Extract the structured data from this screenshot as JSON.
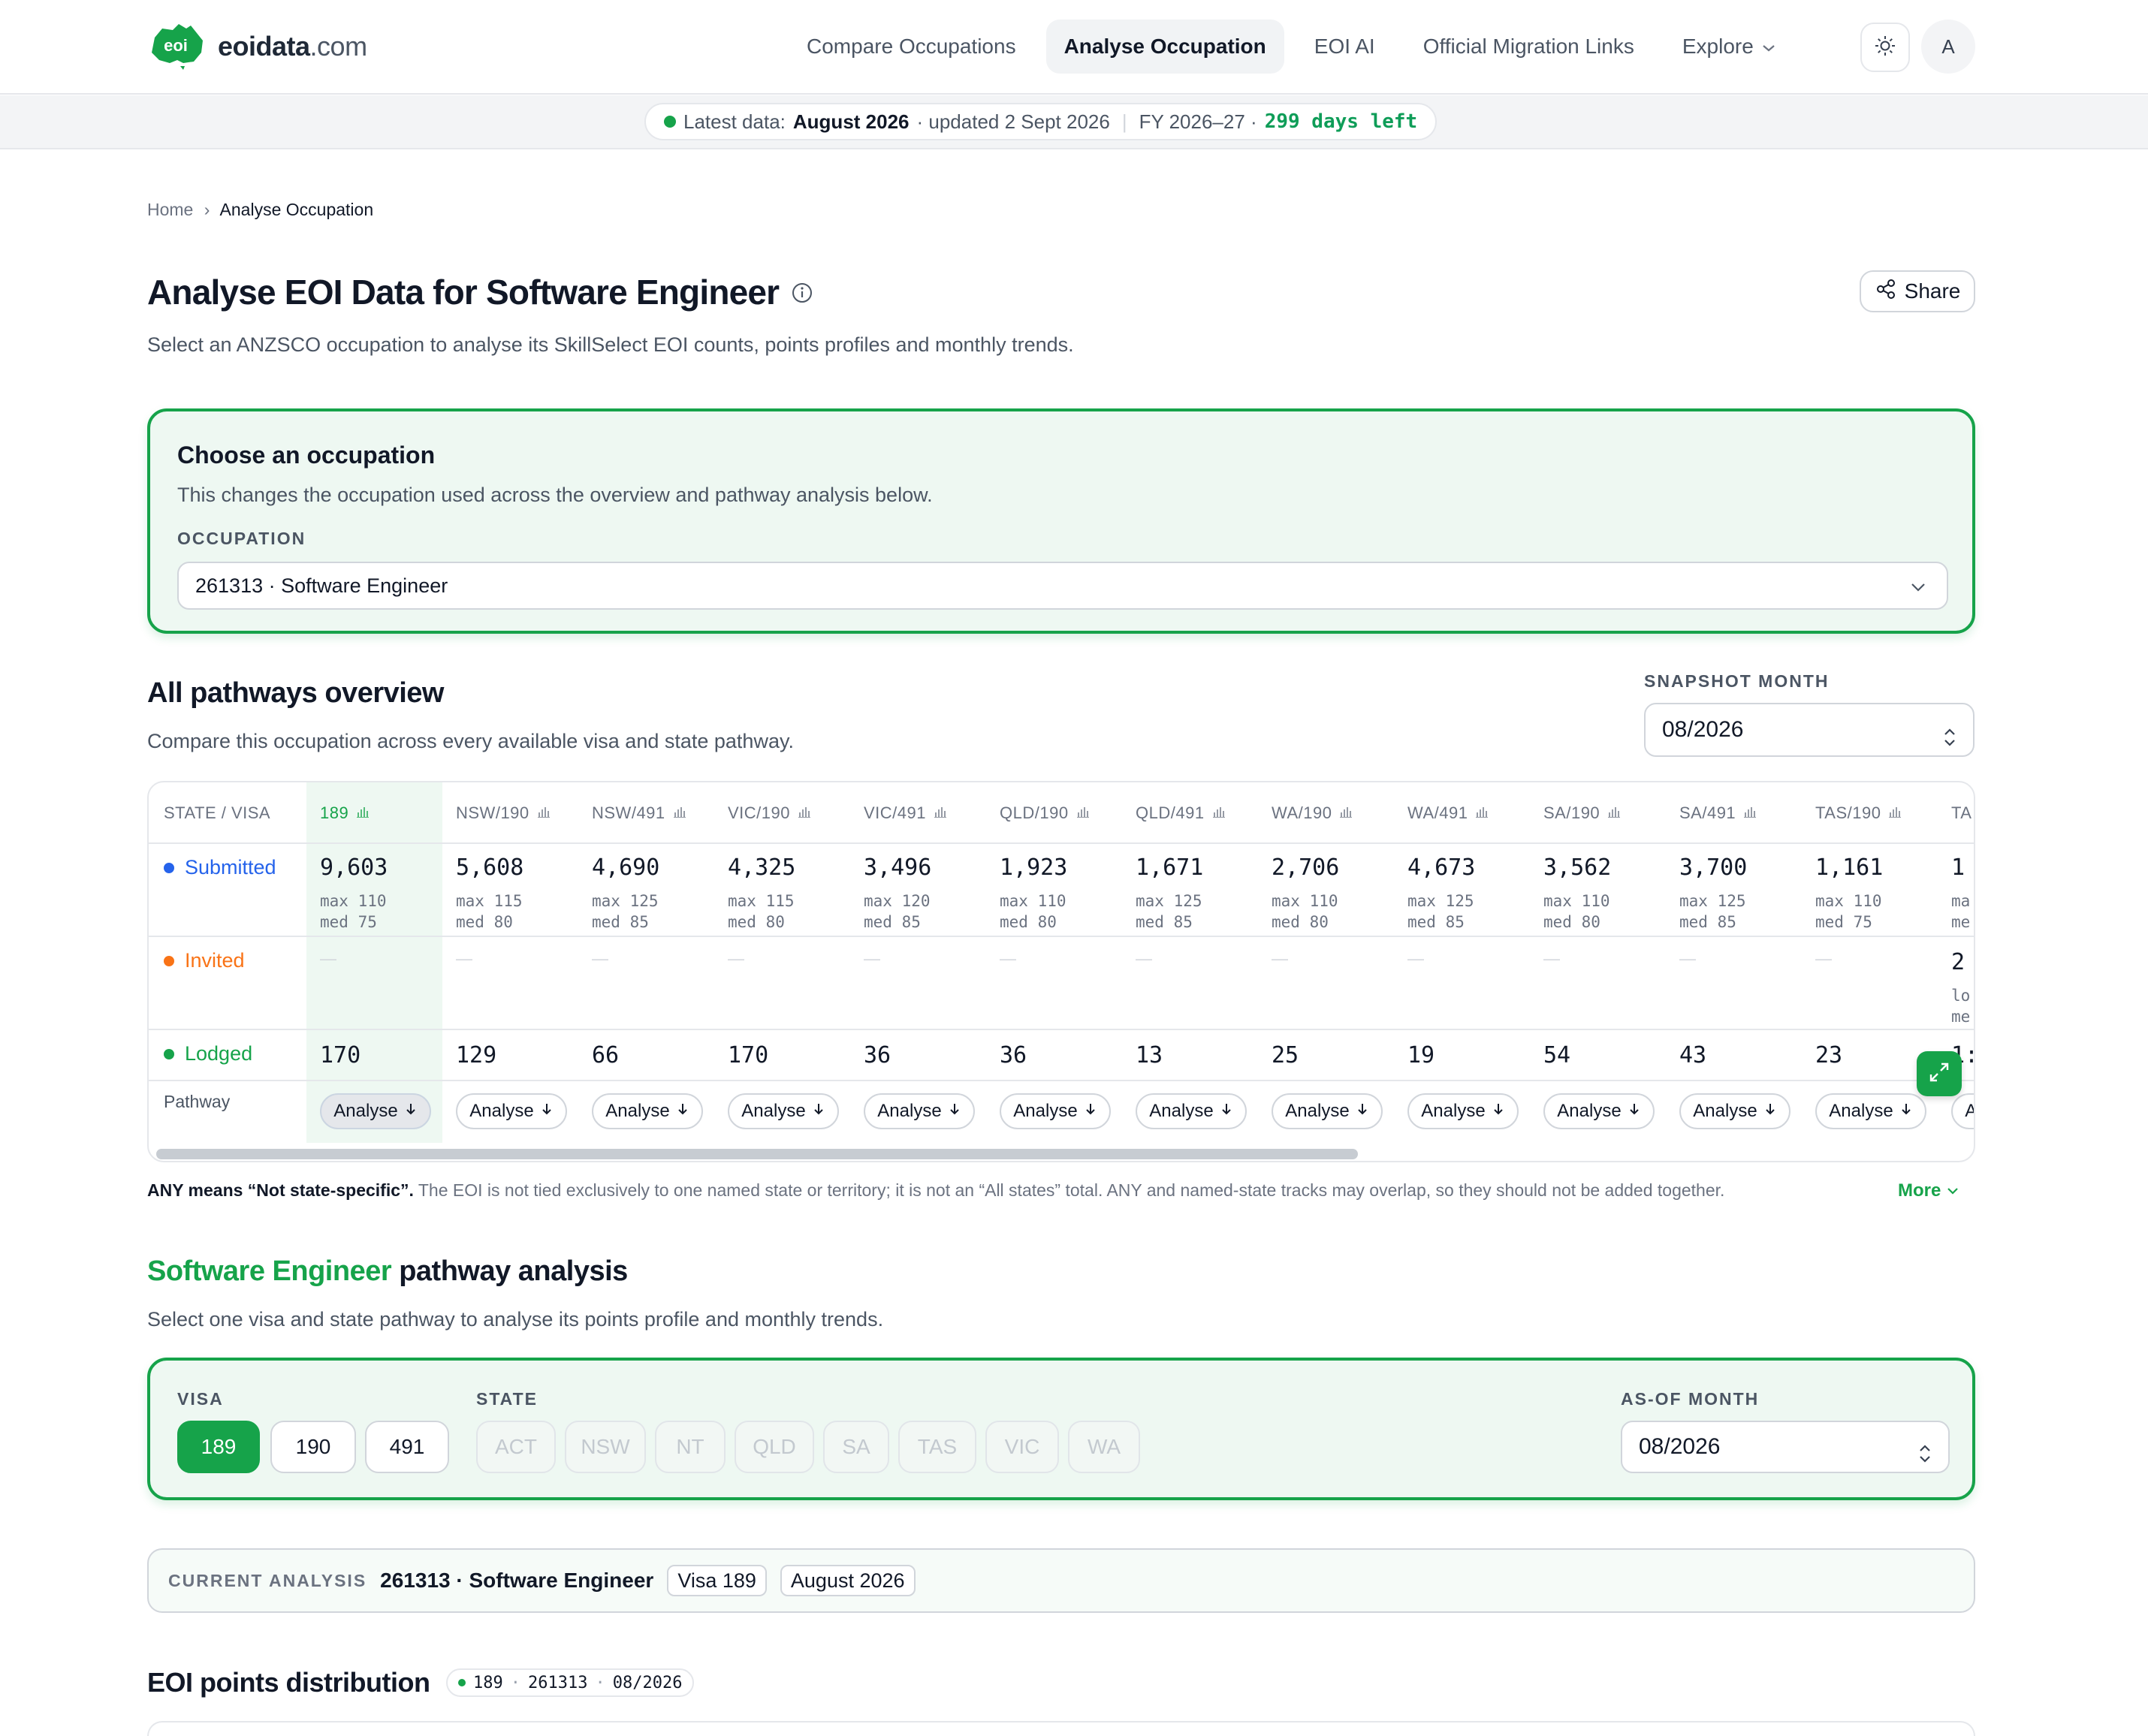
{
  "header": {
    "logo_mark": "eoi",
    "logo_name": "eoidata",
    "logo_tld": ".com",
    "nav": [
      "Compare Occupations",
      "Analyse Occupation",
      "EOI AI",
      "Official Migration Links",
      "Explore"
    ],
    "active_nav": "Analyse Occupation",
    "avatar_initial": "A"
  },
  "status": {
    "label": "Latest data:",
    "month": "August 2026",
    "updated": "· updated 2 Sept 2026",
    "fy": "FY 2026–27 ·",
    "days_left": "299 days left"
  },
  "breadcrumb": {
    "home": "Home",
    "sep": "›",
    "current": "Analyse Occupation"
  },
  "page": {
    "title": "Analyse EOI Data for Software Engineer",
    "subtitle": "Select an ANZSCO occupation to analyse its SkillSelect EOI counts, points profiles and monthly trends.",
    "share_label": "Share"
  },
  "occupation_card": {
    "title": "Choose an occupation",
    "subtitle": "This changes the occupation used across the overview and pathway analysis below.",
    "label": "OCCUPATION",
    "selected": "261313 · Software Engineer"
  },
  "overview": {
    "title": "All pathways overview",
    "subtitle": "Compare this occupation across every available visa and state pathway.",
    "snapshot_label": "SNAPSHOT MONTH",
    "snapshot_value": "08/2026",
    "corner_header": "STATE / VISA",
    "row_labels": {
      "submitted": "Submitted",
      "invited": "Invited",
      "lodged": "Lodged",
      "pathway": "Pathway"
    },
    "analyse_label": "Analyse",
    "dash": "—",
    "columns": [
      {
        "name": "189",
        "submitted": "9,603",
        "max": "max 110",
        "med": "med 75",
        "lodged": "170"
      },
      {
        "name": "NSW/190",
        "submitted": "5,608",
        "max": "max 115",
        "med": "med 80",
        "lodged": "129"
      },
      {
        "name": "NSW/491",
        "submitted": "4,690",
        "max": "max 125",
        "med": "med 85",
        "lodged": "66"
      },
      {
        "name": "VIC/190",
        "submitted": "4,325",
        "max": "max 115",
        "med": "med 80",
        "lodged": "170"
      },
      {
        "name": "VIC/491",
        "submitted": "3,496",
        "max": "max 120",
        "med": "med 85",
        "lodged": "36"
      },
      {
        "name": "QLD/190",
        "submitted": "1,923",
        "max": "max 110",
        "med": "med 80",
        "lodged": "36"
      },
      {
        "name": "QLD/491",
        "submitted": "1,671",
        "max": "max 125",
        "med": "med 85",
        "lodged": "13"
      },
      {
        "name": "WA/190",
        "submitted": "2,706",
        "max": "max 110",
        "med": "med 80",
        "lodged": "25"
      },
      {
        "name": "WA/491",
        "submitted": "4,673",
        "max": "max 125",
        "med": "med 85",
        "lodged": "19"
      },
      {
        "name": "SA/190",
        "submitted": "3,562",
        "max": "max 110",
        "med": "med 80",
        "lodged": "54"
      },
      {
        "name": "SA/491",
        "submitted": "3,700",
        "max": "max 125",
        "med": "med 85",
        "lodged": "43"
      },
      {
        "name": "TAS/190",
        "submitted": "1,161",
        "max": "max 110",
        "med": "med 75",
        "lodged": "23"
      },
      {
        "name": "TA",
        "submitted": "1",
        "max": "ma",
        "med": "me",
        "invited": "2",
        "inv_max": "lo",
        "inv_med": "me",
        "lodged": "1:"
      }
    ],
    "note_bold": "ANY means “Not state-specific”.",
    "note_text": " The EOI is not tied exclusively to one named state or territory; it is not an “All states” total. ANY and named-state tracks may overlap, so they should not be added together.",
    "more_label": "More"
  },
  "pathway": {
    "title_highlight": "Software Engineer",
    "title_rest": " pathway analysis",
    "subtitle": "Select one visa and state pathway to analyse its points profile and monthly trends.",
    "visa_label": "VISA",
    "visas": [
      "189",
      "190",
      "491"
    ],
    "selected_visa": "189",
    "state_label": "STATE",
    "states": [
      "ACT",
      "NSW",
      "NT",
      "QLD",
      "SA",
      "TAS",
      "VIC",
      "WA"
    ],
    "asof_label": "AS-OF MONTH",
    "asof_value": "08/2026"
  },
  "current_analysis": {
    "label": "CURRENT ANALYSIS",
    "occupation": "261313 · Software Engineer",
    "visa_tag": "Visa 189",
    "month_tag": "August 2026"
  },
  "distribution": {
    "title": "EOI points distribution",
    "pill": [
      "189",
      "261313",
      "08/2026"
    ]
  },
  "colors": {
    "accent": "#16a34a",
    "submitted": "#2563eb",
    "invited": "#f97316",
    "lodged": "#16a34a"
  }
}
